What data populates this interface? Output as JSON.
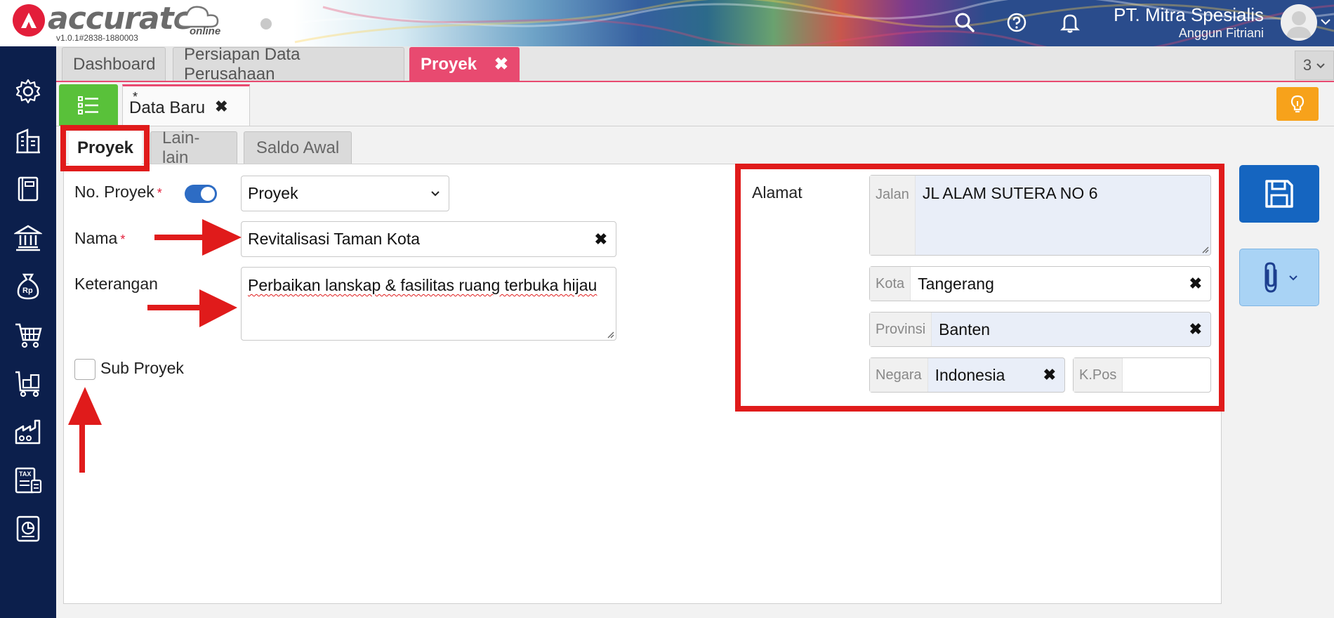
{
  "header": {
    "logo_text": "accurate",
    "logo_sub": "online",
    "version": "v1.0.1#2838-1880003",
    "company_name": "PT. Mitra Spesialis",
    "user_name": "Anggun Fitriani",
    "icons": [
      "search-icon",
      "help-icon",
      "bell-icon"
    ]
  },
  "sidebar": {
    "icons": [
      "gear-icon",
      "building-icon",
      "book-icon",
      "bank-icon",
      "money-bag-icon",
      "cart-icon",
      "delivery-cart-icon",
      "factory-icon",
      "tax-icon",
      "report-icon"
    ]
  },
  "top_tabs": [
    {
      "label": "Dashboard"
    },
    {
      "label": "Persiapan Data Perusahaan"
    },
    {
      "label": "Proyek",
      "active": true
    }
  ],
  "tab_count": "3",
  "doc_tab": {
    "marker": "*",
    "label": "Data Baru"
  },
  "form_tabs": [
    {
      "label": "Proyek",
      "active": true
    },
    {
      "label": "Lain-lain"
    },
    {
      "label": "Saldo Awal"
    }
  ],
  "form": {
    "no_proyek_label": "No. Proyek",
    "required_mark": "*",
    "no_proyek_type": "Proyek",
    "nama_label": "Nama",
    "nama_value": "Revitalisasi Taman Kota",
    "keterangan_label": "Keterangan",
    "keterangan_value": "Perbaikan lanskap & fasilitas ruang terbuka hijau",
    "sub_proyek_label": "Sub Proyek",
    "sub_proyek_checked": false
  },
  "address": {
    "label": "Alamat",
    "jalan_prefix": "Jalan",
    "jalan_value": "JL ALAM SUTERA NO 6",
    "kota_prefix": "Kota",
    "kota_value": "Tangerang",
    "provinsi_prefix": "Provinsi",
    "provinsi_value": "Banten",
    "negara_prefix": "Negara",
    "negara_value": "Indonesia",
    "kpos_prefix": "K.Pos",
    "kpos_value": ""
  },
  "colors": {
    "sidebar_bg": "#0c1f4c",
    "active_tab": "#e84a70",
    "list_button": "#59c13a",
    "hint_button": "#f7a21b",
    "save_button": "#1565c0",
    "annotation_red": "#e01b1b"
  }
}
